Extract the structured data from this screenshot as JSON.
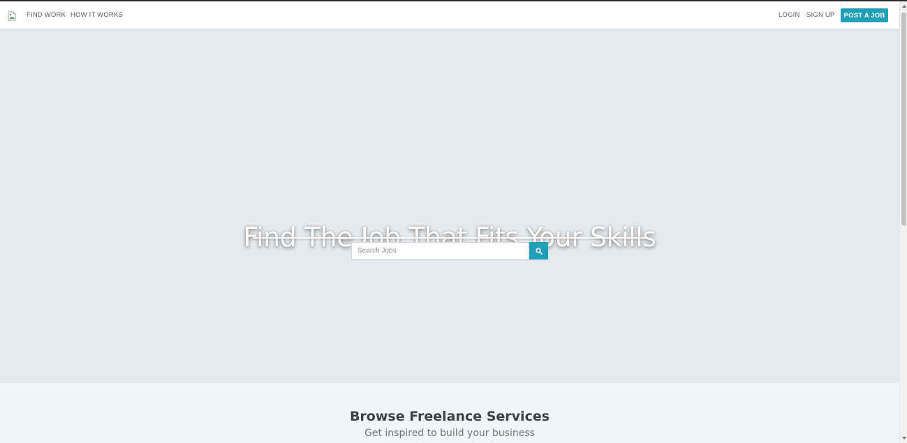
{
  "nav": {
    "logo_icon": "broken-image-icon",
    "find_work": "FIND WORK",
    "how_it_works": "HOW IT WORKS",
    "login": "LOGIN",
    "sign_up": "SIGN UP",
    "post_job": "POST A JOB"
  },
  "hero": {
    "title": "Find The Job That Fits Your Skills",
    "search_placeholder": "Search Jobs",
    "search_value": "",
    "search_icon": "search-icon"
  },
  "browse": {
    "title": "Browse Freelance Services",
    "subtitle": "Get inspired to build your business"
  },
  "colors": {
    "accent": "#1fa0b8",
    "hero_background": "#e6eaed",
    "section_background": "#f3f6f9",
    "navbar_background": "#ffffff"
  }
}
